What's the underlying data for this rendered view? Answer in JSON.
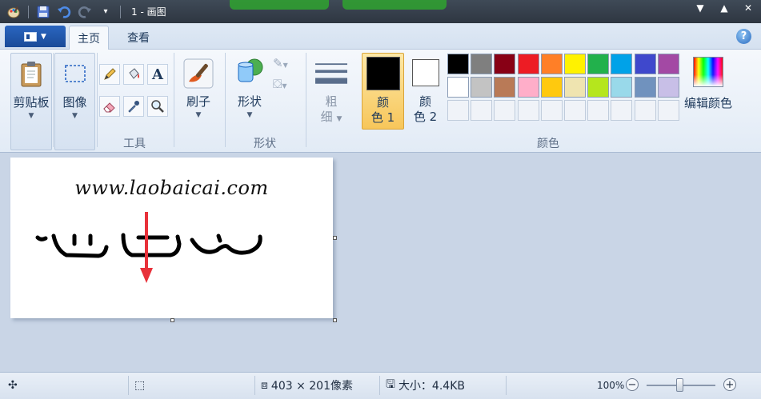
{
  "titlebar": {
    "title": "1 - 画图"
  },
  "tabs": {
    "app_menu": "",
    "home": "主页",
    "view": "查看"
  },
  "ribbon": {
    "clipboard": {
      "label": "剪贴板"
    },
    "image": {
      "label": "图像"
    },
    "tools": {
      "label": "工具",
      "text_tool": "A"
    },
    "brushes": {
      "label": "刷子"
    },
    "shapes": {
      "label": "形状",
      "group_label": "形状"
    },
    "size": {
      "label_line1": "粗",
      "label_line2": "细"
    },
    "color1": {
      "line1": "颜",
      "line2": "色 1",
      "value": "#000000"
    },
    "color2": {
      "line1": "颜",
      "line2": "色 2",
      "value": "#ffffff"
    },
    "colors_group_label": "颜色",
    "edit_colors": "编辑颜色",
    "palette_row1": [
      "#000000",
      "#7f7f7f",
      "#880015",
      "#ed1c24",
      "#ff7f27",
      "#fff200",
      "#22b14c",
      "#00a2e8",
      "#3f48cc",
      "#a349a4"
    ],
    "palette_row2": [
      "#ffffff",
      "#c3c3c3",
      "#b97a57",
      "#ffaec9",
      "#ffc90e",
      "#efe4b0",
      "#b5e61d",
      "#99d9ea",
      "#7092be",
      "#c8bfe7"
    ]
  },
  "canvas": {
    "text": "www.laobaicai.com",
    "arrow_color": "#e8313a"
  },
  "statusbar": {
    "dimensions": "403 × 201像素",
    "size_label": "大小：4.4KB",
    "zoom": "100%"
  }
}
